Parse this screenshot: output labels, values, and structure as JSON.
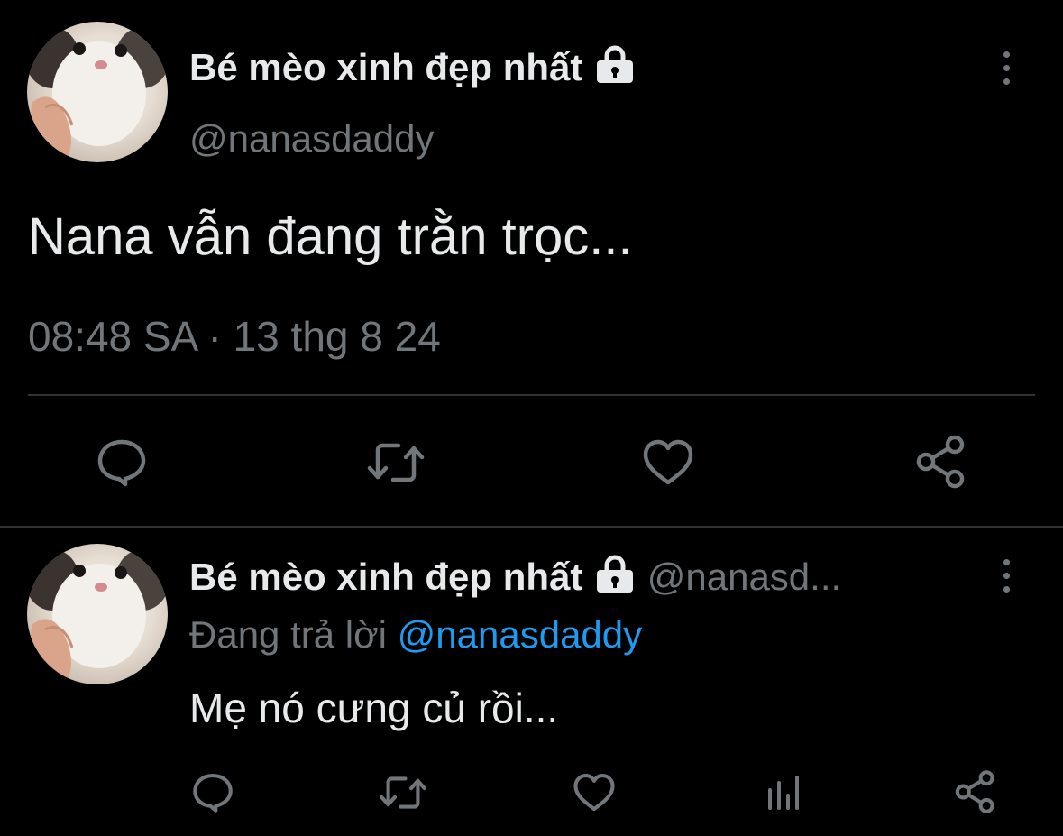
{
  "tweet": {
    "display_name": "Bé mèo xinh đẹp nhất",
    "handle": "@nanasdaddy",
    "text": "Nana vẫn đang trằn trọc...",
    "timestamp": "08:48 SA · 13 thg 8 24",
    "icons": {
      "lock": "lock-icon",
      "more": "more-vertical-icon",
      "reply": "reply-icon",
      "retweet": "retweet-icon",
      "like": "like-icon",
      "share": "share-icon"
    }
  },
  "reply": {
    "display_name": "Bé mèo xinh đẹp nhất",
    "handle_truncated": "@nanasd...",
    "replying_prefix": "Đang trả lời",
    "replying_to": "@nanasdaddy",
    "text": "Mẹ nó cưng củ rồi...",
    "icons": {
      "reply": "reply-icon",
      "retweet": "retweet-icon",
      "like": "like-icon",
      "analytics": "analytics-icon",
      "share": "share-icon"
    }
  },
  "colors": {
    "background": "#000000",
    "text": "#e7e9ea",
    "muted": "#71767b",
    "link": "#1d9bf0",
    "divider": "#2f3336"
  }
}
